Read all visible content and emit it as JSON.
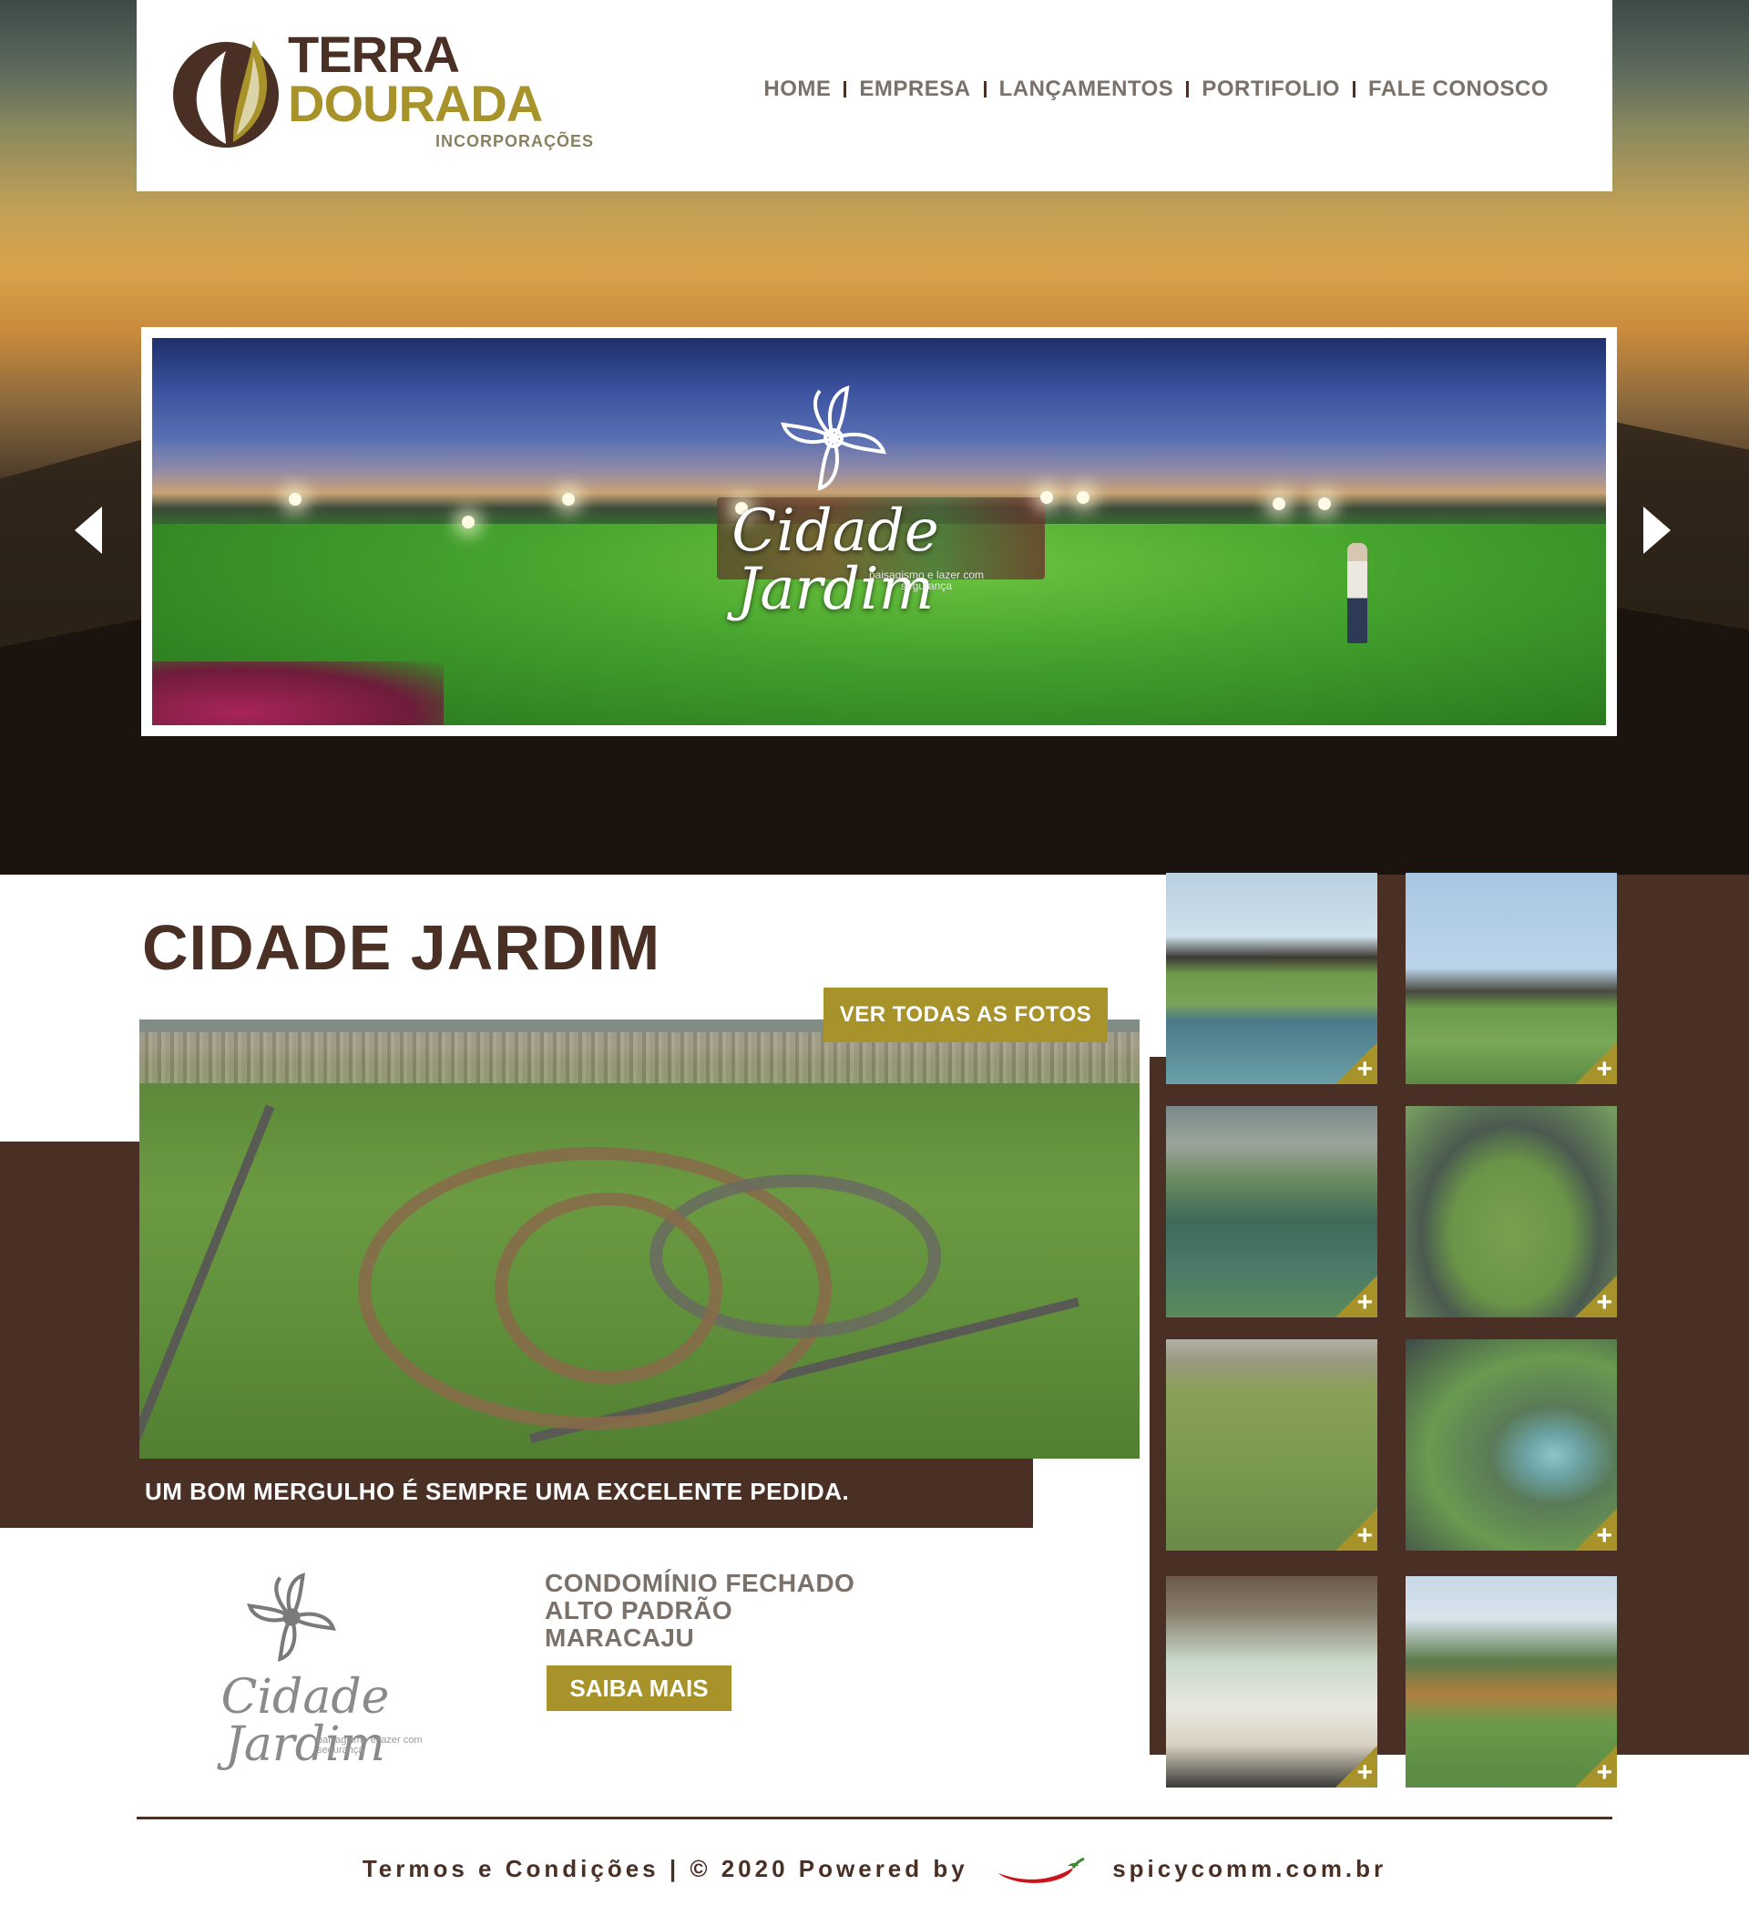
{
  "header": {
    "logo_line1": "TERRA",
    "logo_line2": "DOURADA",
    "logo_sub": "INCORPORAÇÕES",
    "nav": [
      "HOME",
      "EMPRESA",
      "LANÇAMENTOS",
      "PORTIFOLIO",
      "FALE CONOSCO"
    ]
  },
  "slider": {
    "brand_title": "Cidade Jardim",
    "brand_tag": "paisagismo e lazer com segurança",
    "prev_icon": "chevron-left-icon",
    "next_icon": "chevron-right-icon"
  },
  "feature": {
    "title": "CIDADE JARDIM",
    "all_photos_label": "VER TODAS AS FOTOS",
    "caption": "UM BOM MERGULHO É SEMPRE UMA EXCELENTE PEDIDA."
  },
  "project": {
    "logo_name": "Cidade Jardim",
    "logo_tag": "paisagismo e lazer com segurança",
    "lines": [
      "CONDOMÍNIO FECHADO",
      "ALTO PADRÃO",
      "MARACAJU"
    ],
    "cta_label": "SAIBA MAIS"
  },
  "gallery": {
    "plus_label": "+",
    "thumbs": [
      "lake-clubhouse",
      "palm-trees",
      "aerial-lake",
      "aerial-ring",
      "aerial-lots",
      "aerial-pool",
      "kitchen-interior",
      "playground"
    ]
  },
  "footer": {
    "left_text": "Termos e Condições | © 2020 Powered by",
    "right_text": "spicycomm.com.br"
  },
  "colors": {
    "brown": "#4a2f25",
    "gold": "#a8922a",
    "nav_gray": "#7a716a"
  }
}
